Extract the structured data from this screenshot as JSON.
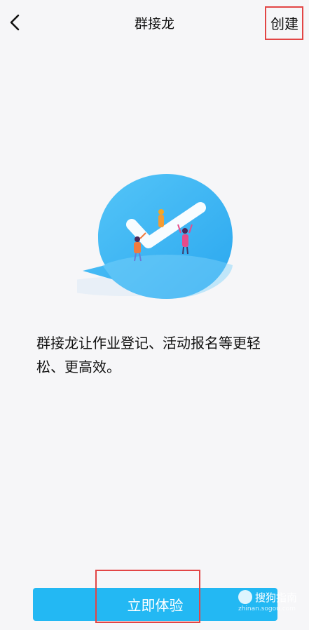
{
  "nav": {
    "title": "群接龙",
    "create_label": "创建",
    "back_icon": "chevron-left-icon"
  },
  "main": {
    "description": "群接龙让作业登记、活动报名等更轻松、更高效。"
  },
  "cta": {
    "label": "立即体验"
  },
  "watermark": {
    "text": "搜狗指南",
    "subtext": "zhinan.sogou.com"
  },
  "colors": {
    "accent": "#23b8f3",
    "highlight": "#e24545",
    "background": "#f6f6f8"
  }
}
